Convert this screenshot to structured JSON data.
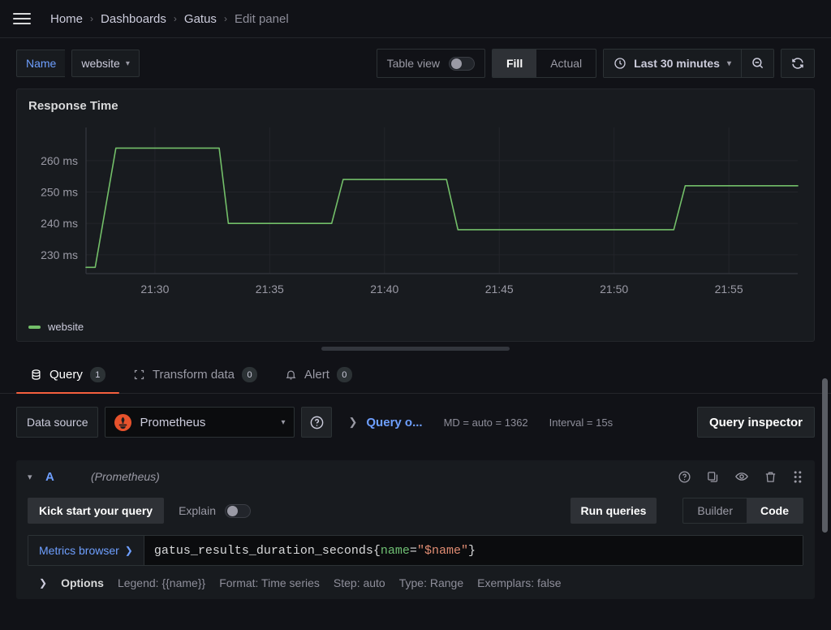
{
  "breadcrumb": {
    "items": [
      "Home",
      "Dashboards",
      "Gatus",
      "Edit panel"
    ],
    "separator": "›",
    "menu_icon": "hamburger-menu-icon"
  },
  "toolbar": {
    "variable_label": "Name",
    "variable_value": "website",
    "table_view_label": "Table view",
    "table_view_on": false,
    "fill_label": "Fill",
    "actual_label": "Actual",
    "fill_selected": true,
    "time_range": "Last 30 minutes",
    "zoom_out_icon": "zoom-out-icon",
    "refresh_icon": "refresh-icon",
    "clock_icon": "clock-icon"
  },
  "panel": {
    "title": "Response Time",
    "legend": [
      {
        "label": "website",
        "color": "#73bf69"
      }
    ]
  },
  "chart_data": {
    "type": "line",
    "title": "Response Time",
    "xlabel": "",
    "ylabel": "",
    "ylim": [
      224,
      268
    ],
    "xlim": [
      "21:27",
      "21:58"
    ],
    "grid": true,
    "legend_position": "bottom-left",
    "y_ticks": [
      230,
      240,
      250,
      260
    ],
    "y_tick_labels": [
      "230 ms",
      "240 ms",
      "250 ms",
      "260 ms"
    ],
    "x_ticks": [
      "21:30",
      "21:35",
      "21:40",
      "21:45",
      "21:50",
      "21:55"
    ],
    "unit": "ms",
    "series": [
      {
        "name": "website",
        "color": "#73bf69",
        "x": [
          "21:27.0",
          "21:27.4",
          "21:28.3",
          "21:32.8",
          "21:33.2",
          "21:37.7",
          "21:38.2",
          "21:42.7",
          "21:43.2",
          "21:52.6",
          "21:53.1",
          "21:58.0"
        ],
        "values": [
          226,
          226,
          264,
          264,
          240,
          240,
          254,
          254,
          238,
          238,
          252,
          252
        ]
      }
    ]
  },
  "tabs": [
    {
      "label": "Query",
      "count": "1",
      "icon": "database-icon",
      "active": true
    },
    {
      "label": "Transform data",
      "count": "0",
      "icon": "transform-icon",
      "active": false
    },
    {
      "label": "Alert",
      "count": "0",
      "icon": "bell-icon",
      "active": false
    }
  ],
  "query_editor": {
    "data_source_label": "Data source",
    "data_source_name": "Prometheus",
    "data_source_icon": "prometheus-logo-icon",
    "help_icon": "help-circle-icon",
    "query_options_label": "Query o...",
    "max_data_points": "MD = auto = 1362",
    "interval": "Interval = 15s",
    "query_inspector_label": "Query inspector"
  },
  "query_row": {
    "ref_id": "A",
    "datasource": "(Prometheus)",
    "collapse_icon": "chevron-down-icon",
    "actions": [
      "help-circle-icon",
      "duplicate-icon",
      "eye-icon",
      "trash-icon",
      "drag-handle-icon"
    ],
    "kick_start_label": "Kick start your query",
    "explain_label": "Explain",
    "explain_on": false,
    "run_queries_label": "Run queries",
    "builder_label": "Builder",
    "code_label": "Code",
    "mode_selected": "Code",
    "metrics_browser_label": "Metrics browser",
    "expression": {
      "metric": "gatus_results_duration_seconds{",
      "label_key": "name",
      "equals": "=",
      "label_value": "\"$name\"",
      "close": "}"
    },
    "options": {
      "title": "Options",
      "items": [
        "Legend: {{name}}",
        "Format: Time series",
        "Step: auto",
        "Type: Range",
        "Exemplars: false"
      ]
    }
  }
}
